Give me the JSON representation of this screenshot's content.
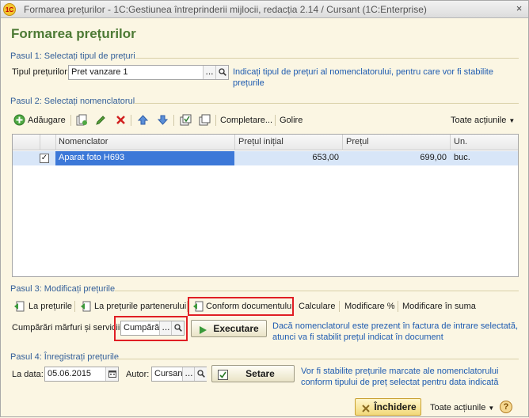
{
  "window": {
    "title": "Formarea prețurilor - 1C:Gestiunea întreprinderii mijlocii, redacția 2.14 / Cursant  (1C:Enterprise)",
    "app_icon_text": "1C",
    "close_glyph": "×"
  },
  "form_title": "Formarea prețurilor",
  "step1": {
    "heading": "Pasul 1: Selectați tipul de prețuri",
    "price_type_label": "Tipul prețurilor:",
    "price_type_value": "Pret vanzare 1",
    "dots": "...",
    "hint": "Indicați tipul de prețuri al nomenclatorului, pentru care vor fi stabilite prețurile"
  },
  "step2": {
    "heading": "Pasul 2: Selectați nomenclatorul",
    "toolbar": {
      "add": "Adăugare",
      "complete": "Completare...",
      "clear": "Golire",
      "all_actions": "Toate acțiunile"
    },
    "table": {
      "columns": [
        "Nomenclator",
        "Prețul inițial",
        "Prețul",
        "Un."
      ],
      "rows": [
        {
          "checked": "✓",
          "name": "Aparat foto H693",
          "initial_price": "653,00",
          "price": "699,00",
          "unit": "buc."
        }
      ]
    }
  },
  "step3": {
    "heading": "Pasul 3: Modificați prețurile",
    "actions": {
      "by_prices": "La prețurile",
      "by_partner_prices": "La prețurile partenerului",
      "by_document": "Conform documentului",
      "calculate": "Calculare",
      "modify_percent": "Modificare %",
      "modify_sum": "Modificare în suma"
    },
    "doc_label": "Cumpărări mărfuri și servicii:",
    "doc_value": "Cumpărări",
    "dots": "...",
    "execute": "Executare",
    "hint": "Dacă nomenclatorul este prezent în factura de intrare selectată, atunci va fi stabilit prețul indicat în document"
  },
  "step4": {
    "heading": "Pasul 4: Înregistrați prețurile",
    "date_label": "La data:",
    "date_value": "05.06.2015",
    "author_label": "Autor:",
    "author_value": "Cursant",
    "dots": "...",
    "set": "Setare",
    "hint": "Vor fi stabilite prețurile marcate ale nomenclatorului conform tipului de preț selectat pentru data indicată"
  },
  "footer": {
    "close": "Închidere",
    "all_actions": "Toate acțiunile",
    "help": "?"
  },
  "colors": {
    "background": "#fbf6e3",
    "title_green": "#4d7a35",
    "section_blue": "#335f99",
    "hint_blue": "#1e5bb0",
    "selection": "#3c78d8",
    "highlight_red": "#e01e24"
  }
}
